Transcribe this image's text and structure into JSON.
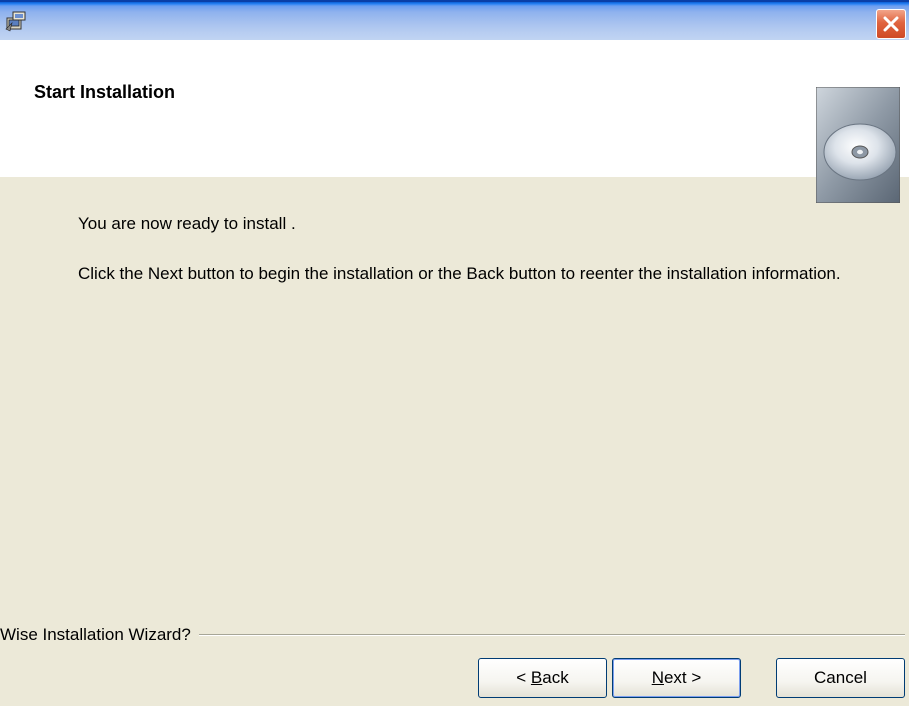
{
  "window": {
    "title": "",
    "close_icon": "close-icon",
    "app_icon": "installer-icon"
  },
  "header": {
    "title": "Start Installation",
    "image": "cd-disc-icon"
  },
  "body": {
    "ready_text": "You are now ready to install .",
    "instructions": "Click the Next button to begin the installation or the Back button to reenter the installation information."
  },
  "footer": {
    "group_label": "Wise Installation Wizard?",
    "buttons": {
      "back": {
        "prefix": "< ",
        "mnemonic": "B",
        "rest": "ack"
      },
      "next": {
        "prefix": "",
        "mnemonic": "N",
        "rest": "ext >"
      },
      "cancel": "Cancel"
    }
  },
  "colors": {
    "dialog_bg": "#ece9d8",
    "header_bg": "#ffffff",
    "title_bar": "#a9c3ef",
    "close_button": "#e0643f",
    "button_border": "#003c74"
  }
}
